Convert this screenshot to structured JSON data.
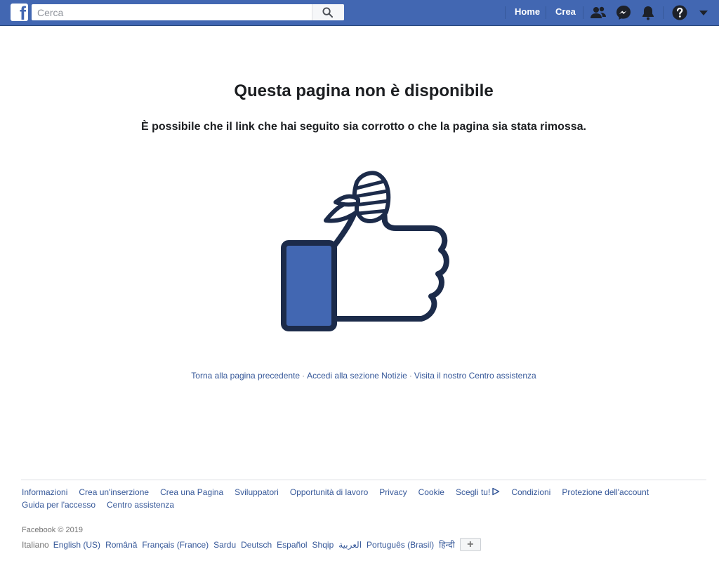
{
  "topbar": {
    "logo": "f",
    "search_placeholder": "Cerca",
    "home_label": "Home",
    "create_label": "Crea",
    "icons": [
      "search-icon",
      "friends-icon",
      "messenger-icon",
      "notifications-icon",
      "help-icon",
      "account-menu-icon"
    ]
  },
  "main": {
    "title": "Questa pagina non è disponibile",
    "subtitle": "È possibile che il link che hai seguito sia corrotto o che la pagina sia stata rimossa.",
    "illustration": "broken-thumbs-up-icon",
    "links": [
      "Torna alla pagina precedente",
      "Accedi alla sezione Notizie",
      "Visita il nostro Centro assistenza"
    ],
    "separator": "·"
  },
  "footer": {
    "row1": [
      "Informazioni",
      "Crea un'inserzione",
      "Crea una Pagina",
      "Sviluppatori",
      "Opportunità di lavoro",
      "Privacy",
      "Cookie",
      "Scegli tu!",
      "Condizioni",
      "Protezione dell'account"
    ],
    "row2": [
      "Guida per l'accesso",
      "Centro assistenza"
    ],
    "copyright": "Facebook © 2019",
    "current_language": "Italiano",
    "languages": [
      "English (US)",
      "Română",
      "Français (France)",
      "Sardu",
      "Deutsch",
      "Español",
      "Shqip",
      "العربية",
      "Português (Brasil)",
      "हिन्दी"
    ],
    "more_languages_label": "+"
  },
  "colors": {
    "brand": "#4267b2",
    "link": "#365899",
    "thumb_fill": "#4267b2",
    "thumb_outline": "#1c2b4a"
  }
}
